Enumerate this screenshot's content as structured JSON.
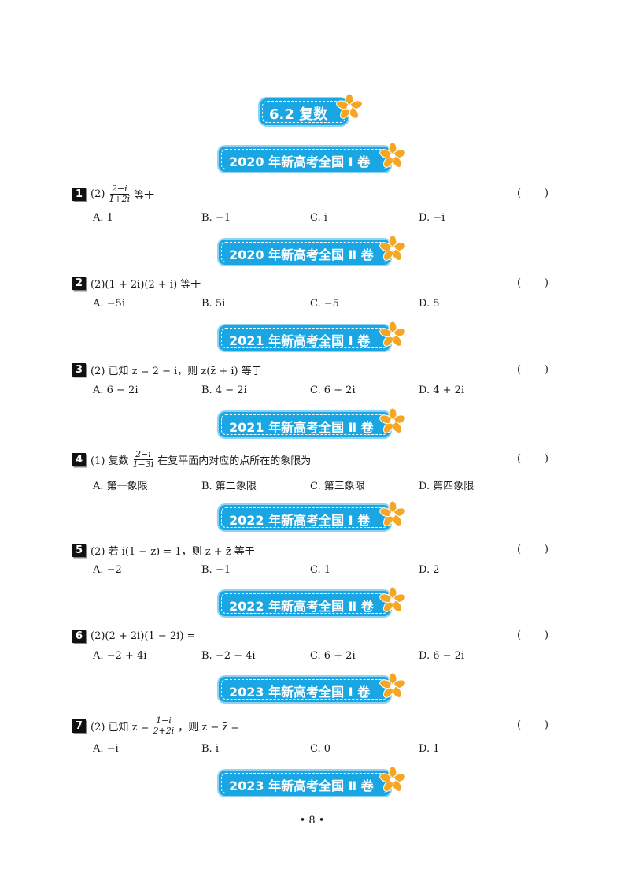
{
  "title": "6.2 复数",
  "sections": [
    {
      "banner": "2020 年新高考全国 Ⅰ 卷"
    },
    {
      "banner": "2020 年新高考全国 Ⅱ 卷"
    },
    {
      "banner": "2021 年新高考全国 Ⅰ 卷"
    },
    {
      "banner": "2021 年新高考全国 Ⅱ 卷"
    },
    {
      "banner": "2022 年新高考全国 Ⅰ 卷"
    },
    {
      "banner": "2022 年新高考全国 Ⅱ 卷"
    },
    {
      "banner": "2023 年新高考全国 Ⅰ 卷"
    },
    {
      "banner": "2023 年新高考全国 Ⅱ 卷"
    }
  ],
  "questions": [
    {
      "num": "1",
      "prefix": "(2)",
      "frac_num": "2−i",
      "frac_den": "1+2i",
      "suffix": " 等于",
      "options": [
        "A. 1",
        "B. −1",
        "C. i",
        "D. −i"
      ]
    },
    {
      "num": "2",
      "prefix": "(2)(1 + 2i)(2 + i) 等于",
      "frac_num": "",
      "frac_den": "",
      "suffix": "",
      "options": [
        "A. −5i",
        "B. 5i",
        "C. −5",
        "D. 5"
      ]
    },
    {
      "num": "3",
      "prefix": "(2) 已知 z = 2 − i，则 z(z̄ + i) 等于",
      "frac_num": "",
      "frac_den": "",
      "suffix": "",
      "options": [
        "A. 6 − 2i",
        "B. 4 − 2i",
        "C. 6 + 2i",
        "D. 4 + 2i"
      ]
    },
    {
      "num": "4",
      "prefix": "(1) 复数",
      "frac_num": "2−i",
      "frac_den": "1−3i",
      "suffix": " 在复平面内对应的点所在的象限为",
      "options": [
        "A. 第一象限",
        "B. 第二象限",
        "C. 第三象限",
        "D. 第四象限"
      ]
    },
    {
      "num": "5",
      "prefix": "(2) 若 i(1 − z) = 1，则 z + z̄ 等于",
      "frac_num": "",
      "frac_den": "",
      "suffix": "",
      "options": [
        "A. −2",
        "B. −1",
        "C. 1",
        "D. 2"
      ]
    },
    {
      "num": "6",
      "prefix": "(2)(2 + 2i)(1 − 2i) =",
      "frac_num": "",
      "frac_den": "",
      "suffix": "",
      "options": [
        "A. −2 + 4i",
        "B. −2 − 4i",
        "C. 6 + 2i",
        "D. 6 − 2i"
      ]
    },
    {
      "num": "7",
      "prefix": "(2) 已知 z =",
      "frac_num": "1−i",
      "frac_den": "2+2i",
      "suffix": "，则 z − z̄ =",
      "options": [
        "A. −i",
        "B. i",
        "C. 0",
        "D. 1"
      ]
    }
  ],
  "paren_open": "(",
  "paren_close": ")",
  "page_number": "• 8 •",
  "colors": {
    "banner": "#1aa6e3",
    "flower": "#f5a623",
    "flower_center": "#ffffff"
  },
  "icons": [
    "flower-icon"
  ]
}
